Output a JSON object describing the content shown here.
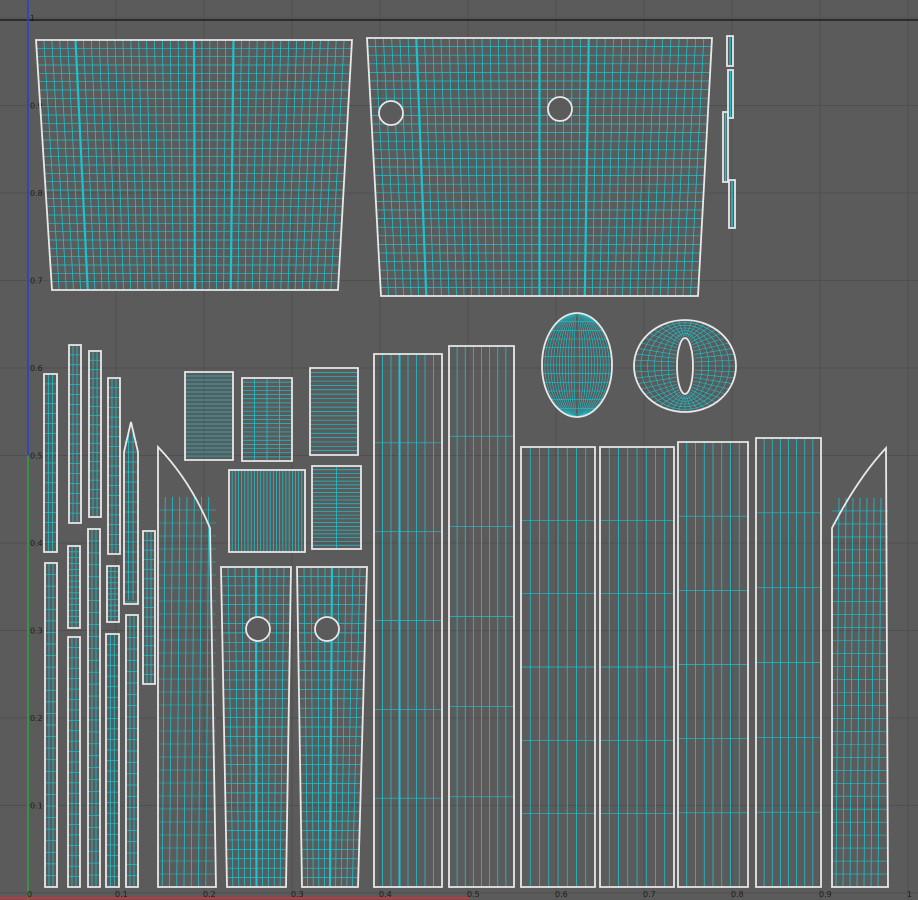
{
  "viewport": {
    "background": "#5b5b5b",
    "grid_color": "#4f4f4f",
    "shell_outline_color": "#e8e8e8",
    "wire_color": "#19c3cf",
    "u_axis_color": "#c8323c",
    "v_axis_color": "#2ea43a",
    "origin_axis_color": "#2b40c9",
    "top_edge_color": "#111111"
  },
  "axes": {
    "u_ticks": [
      "0",
      "0.1",
      "0.2",
      "0.3",
      "0.4",
      "0.5",
      "0.6",
      "0.7",
      "0.8",
      "0.9",
      "1"
    ],
    "v_ticks": [
      "0.1",
      "0.2",
      "0.3",
      "0.4",
      "0.5",
      "0.6",
      "0.7",
      "0.8",
      "0.9",
      "1"
    ]
  }
}
